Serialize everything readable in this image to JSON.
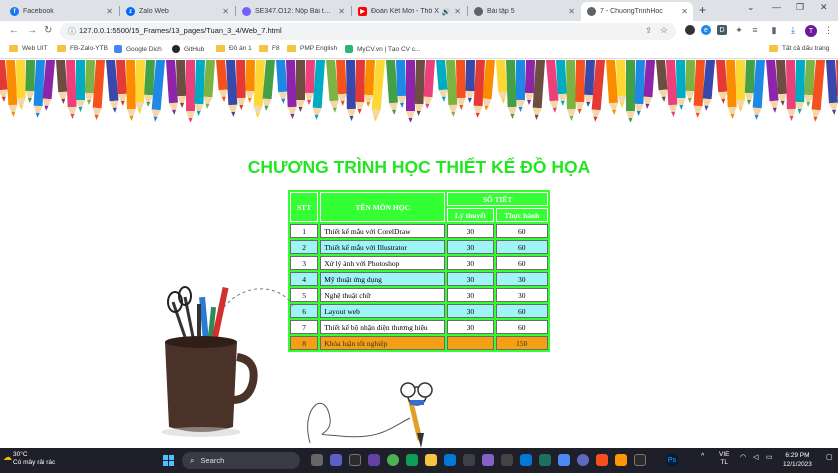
{
  "browser": {
    "tabs": [
      {
        "title": "Facebook",
        "icon": "facebook-icon",
        "color": "#1877f2"
      },
      {
        "title": "Zalo Web",
        "icon": "zalo-icon",
        "color": "#0068ff"
      },
      {
        "title": "SE347.O12: Nộp Bài tập Tr",
        "icon": "course-icon",
        "color": "#7a5cff"
      },
      {
        "title": "Đoàn Kết Mới - Thổ X",
        "icon": "youtube-icon",
        "color": "#ff0000"
      },
      {
        "title": "Bài tập 5",
        "icon": "globe-icon",
        "color": "#5f6368"
      },
      {
        "title": "7 - ChuongTrinhHoc",
        "icon": "globe-icon",
        "color": "#5f6368",
        "active": true
      }
    ],
    "url": "127.0.0.1:5500/15_Frames/13_pages/Tuan_3_4/Web_7.html",
    "bookmarks": [
      {
        "label": "Web UIT",
        "type": "folder"
      },
      {
        "label": "FB-Zalo-YTB",
        "type": "folder"
      },
      {
        "label": "Google Dich",
        "type": "site"
      },
      {
        "label": "GitHub",
        "type": "site"
      },
      {
        "label": "Đồ án 1",
        "type": "folder"
      },
      {
        "label": "F8",
        "type": "folder"
      },
      {
        "label": "PMP English",
        "type": "folder"
      },
      {
        "label": "MyCV.vn | Tạo CV c...",
        "type": "site"
      }
    ],
    "all_bookmarks": "Tất cả dấu trang",
    "profile_initial": "T"
  },
  "page": {
    "title": "CHƯƠNG TRÌNH HỌC THIẾT KẾ ĐỒ HỌA",
    "title_color": "#22e622",
    "table": {
      "headers": {
        "stt": "STT",
        "course": "TÊN MÔN HỌC",
        "periods": "SỐ TIẾT",
        "theory": "Lý thuyết",
        "practice": "Thực hành"
      },
      "rows": [
        {
          "stt": "1",
          "name": "Thiết kế mẫu với CorelDraw",
          "theory": "30",
          "practice": "60"
        },
        {
          "stt": "2",
          "name": "Thiết kế mẫu với Illustrator",
          "theory": "30",
          "practice": "60"
        },
        {
          "stt": "3",
          "name": "Xử lý ảnh với Photoshop",
          "theory": "30",
          "practice": "60"
        },
        {
          "stt": "4",
          "name": "Mỹ thuật ứng dụng",
          "theory": "30",
          "practice": "30"
        },
        {
          "stt": "5",
          "name": "Nghệ thuật chữ",
          "theory": "30",
          "practice": "30"
        },
        {
          "stt": "6",
          "name": "Layout web",
          "theory": "30",
          "practice": "60"
        },
        {
          "stt": "7",
          "name": "Thiết kế bộ nhận diện thương hiệu",
          "theory": "30",
          "practice": "60"
        },
        {
          "stt": "8",
          "name": "Khóa luận tốt nghiệp",
          "theory": "",
          "practice": "150"
        }
      ],
      "colors": {
        "border": "#33ff33",
        "odd": "#ffffff",
        "even": "#9ff5f5",
        "last": "#f59f12"
      }
    }
  },
  "taskbar": {
    "weather_temp": "30°C",
    "weather_desc": "Có mây rải rác",
    "search_placeholder": "Search",
    "language": "VIE",
    "input_mode": "TL",
    "time": "6:29 PM",
    "date": "12/1/2023"
  }
}
